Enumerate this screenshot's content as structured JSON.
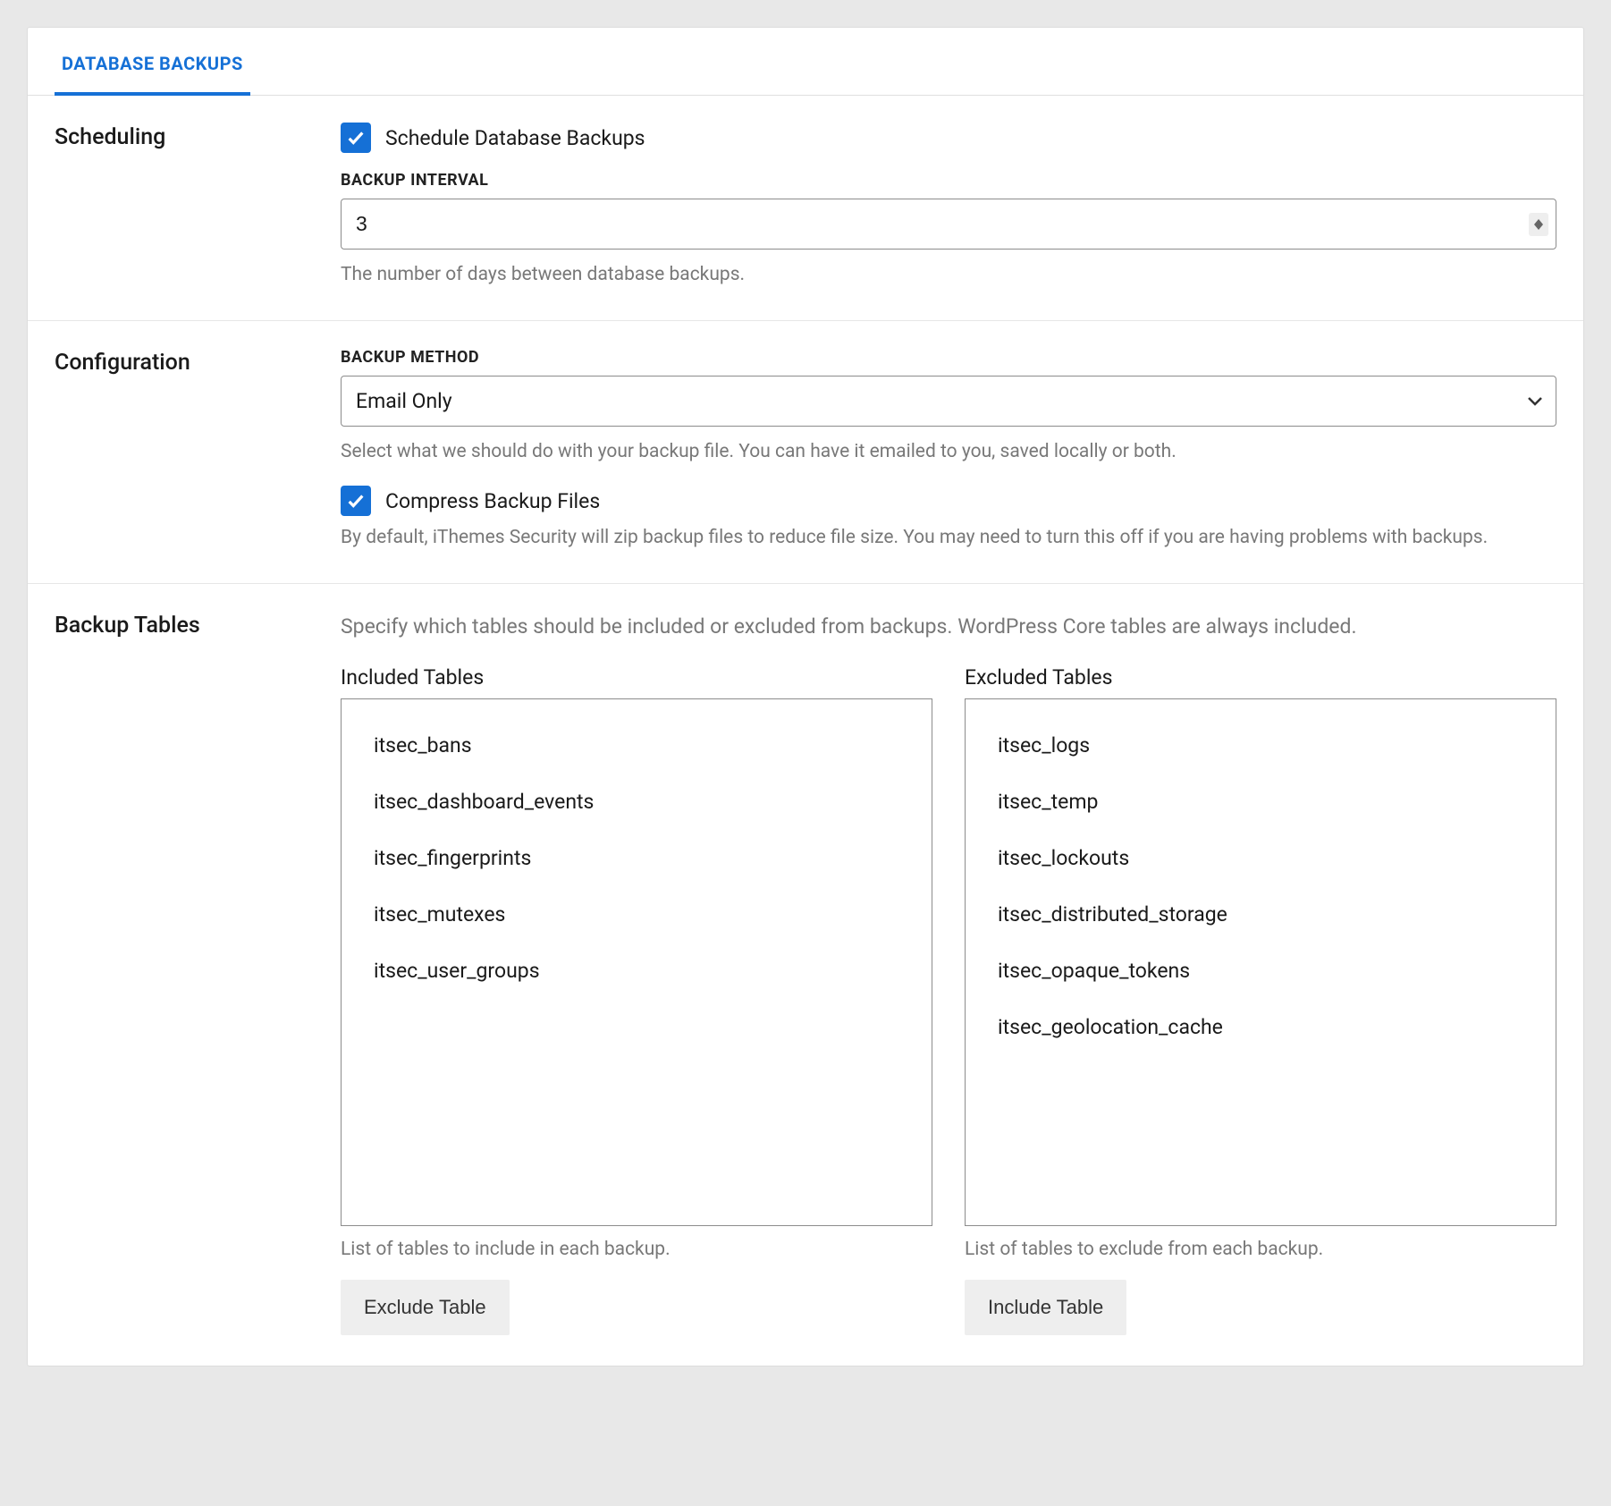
{
  "tab": {
    "label": "DATABASE BACKUPS"
  },
  "scheduling": {
    "title": "Scheduling",
    "schedule_checkbox_label": "Schedule Database Backups",
    "schedule_checked": true,
    "interval_label": "BACKUP INTERVAL",
    "interval_value": "3",
    "interval_help": "The number of days between database backups."
  },
  "configuration": {
    "title": "Configuration",
    "method_label": "BACKUP METHOD",
    "method_value": "Email Only",
    "method_help": "Select what we should do with your backup file. You can have it emailed to you, saved locally or both.",
    "compress_label": "Compress Backup Files",
    "compress_checked": true,
    "compress_help": "By default, iThemes Security will zip backup files to reduce file size. You may need to turn this off if you are having problems with backups."
  },
  "backup_tables": {
    "title": "Backup Tables",
    "description": "Specify which tables should be included or excluded from backups. WordPress Core tables are always included.",
    "included": {
      "heading": "Included Tables",
      "items": [
        "itsec_bans",
        "itsec_dashboard_events",
        "itsec_fingerprints",
        "itsec_mutexes",
        "itsec_user_groups"
      ],
      "help": "List of tables to include in each backup.",
      "button_label": "Exclude Table"
    },
    "excluded": {
      "heading": "Excluded Tables",
      "items": [
        "itsec_logs",
        "itsec_temp",
        "itsec_lockouts",
        "itsec_distributed_storage",
        "itsec_opaque_tokens",
        "itsec_geolocation_cache"
      ],
      "help": "List of tables to exclude from each backup.",
      "button_label": "Include Table"
    }
  }
}
